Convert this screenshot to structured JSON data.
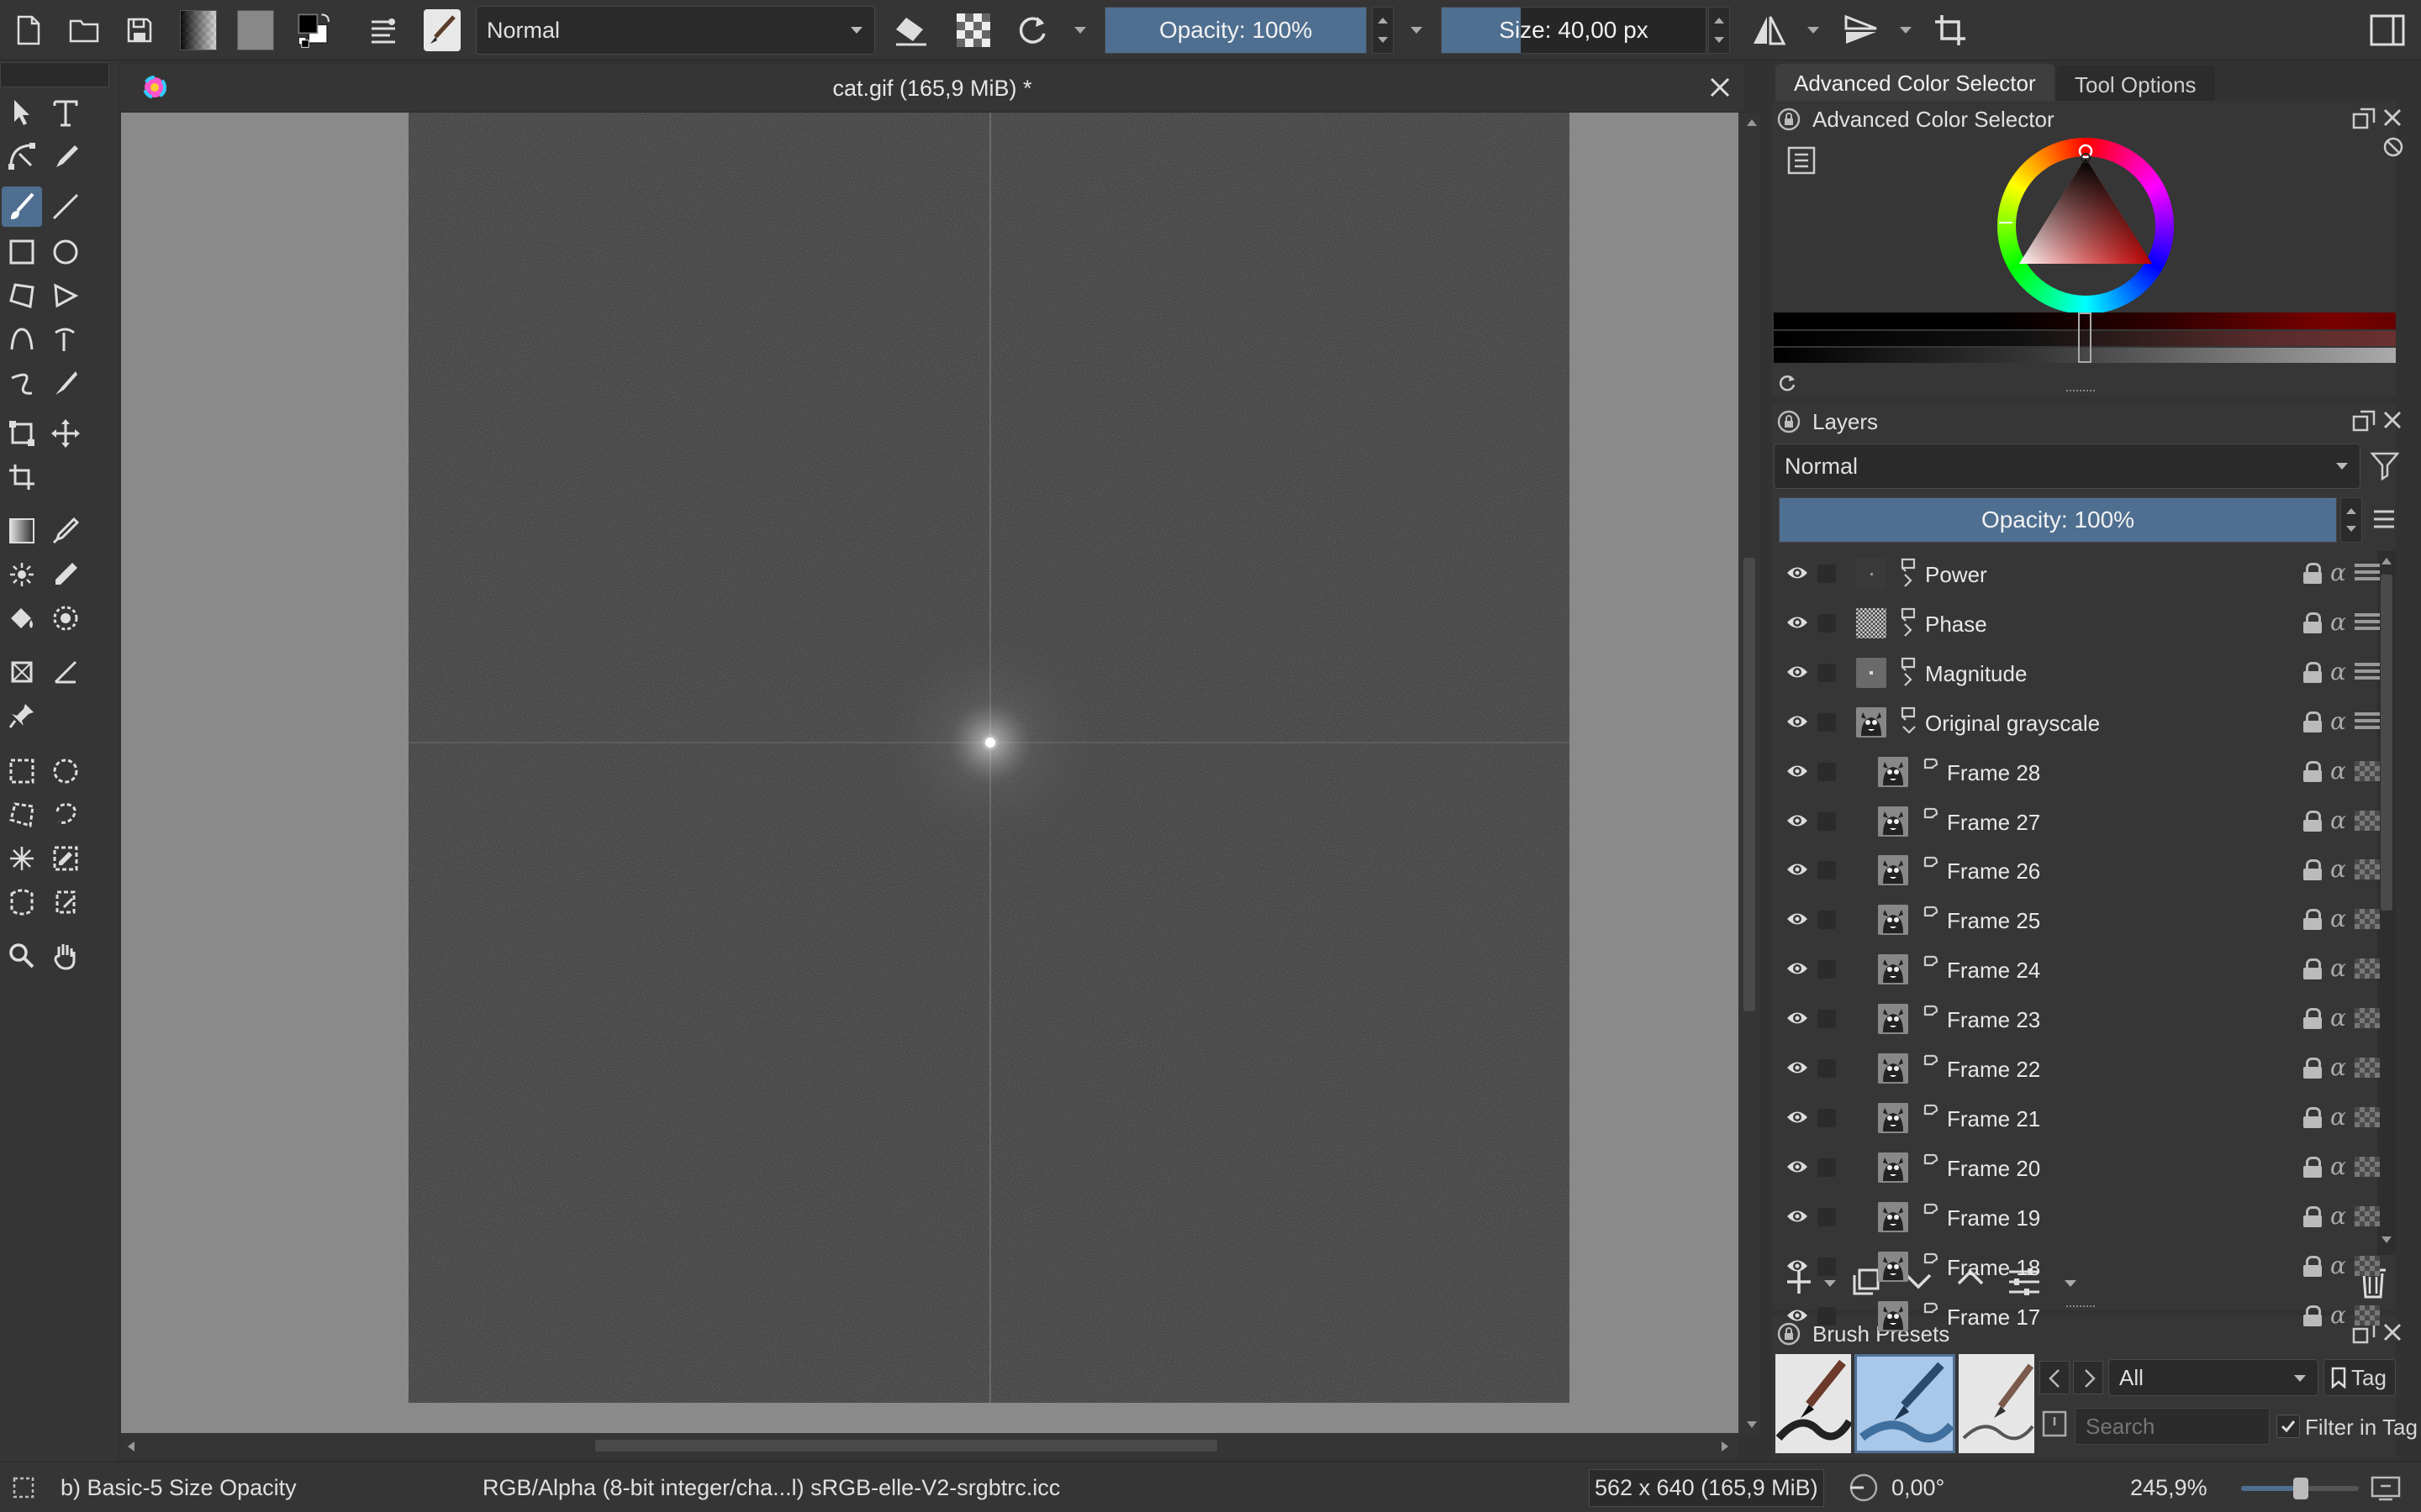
{
  "toolbar": {
    "blend_mode": "Normal",
    "opacity_label": "Opacity: 100%",
    "opacity_value": 1.0,
    "size_label": "Size: 40,00 px",
    "size_value": 0.3
  },
  "document": {
    "title": "cat.gif (165,9 MiB) *"
  },
  "right_tabs": {
    "advanced_color_selector": "Advanced Color Selector",
    "tool_options": "Tool Options"
  },
  "color_panel": {
    "title": "Advanced Color Selector"
  },
  "layers_panel": {
    "title": "Layers",
    "blend_mode": "Normal",
    "opacity_label": "Opacity:  100%",
    "layers": [
      {
        "name": "Power",
        "kind": "filter",
        "thumb": "dark"
      },
      {
        "name": "Phase",
        "kind": "filter",
        "thumb": "noise"
      },
      {
        "name": "Magnitude",
        "kind": "filter",
        "thumb": "gray"
      },
      {
        "name": "Original grayscale",
        "kind": "group",
        "thumb": "cat"
      },
      {
        "name": "Frame 28",
        "kind": "frame",
        "thumb": "cat"
      },
      {
        "name": "Frame 27",
        "kind": "frame",
        "thumb": "cat"
      },
      {
        "name": "Frame 26",
        "kind": "frame",
        "thumb": "cat"
      },
      {
        "name": "Frame 25",
        "kind": "frame",
        "thumb": "cat"
      },
      {
        "name": "Frame 24",
        "kind": "frame",
        "thumb": "cat"
      },
      {
        "name": "Frame 23",
        "kind": "frame",
        "thumb": "cat"
      },
      {
        "name": "Frame 22",
        "kind": "frame",
        "thumb": "cat"
      },
      {
        "name": "Frame 21",
        "kind": "frame",
        "thumb": "cat"
      },
      {
        "name": "Frame 20",
        "kind": "frame",
        "thumb": "cat"
      },
      {
        "name": "Frame 19",
        "kind": "frame",
        "thumb": "cat"
      },
      {
        "name": "Frame 18",
        "kind": "frame",
        "thumb": "cat"
      },
      {
        "name": "Frame 17",
        "kind": "frame",
        "thumb": "cat"
      }
    ]
  },
  "brush_presets": {
    "title": "Brush Presets",
    "tag_filter": "All",
    "tag_button": "Tag",
    "search_placeholder": "Search",
    "filter_in_tag": "Filter in Tag"
  },
  "status": {
    "brush": "b) Basic-5 Size Opacity",
    "color_model": "RGB/Alpha (8-bit integer/cha...l)  sRGB-elle-V2-srgbtrc.icc",
    "image_size": "562 x 640 (165,9 MiB)",
    "rotation": "0,00°",
    "zoom": "245,9%"
  },
  "colors": {
    "accent": "#4f6f91",
    "panel_bg": "#323232",
    "canvas_bg": "#8a8a8a"
  }
}
